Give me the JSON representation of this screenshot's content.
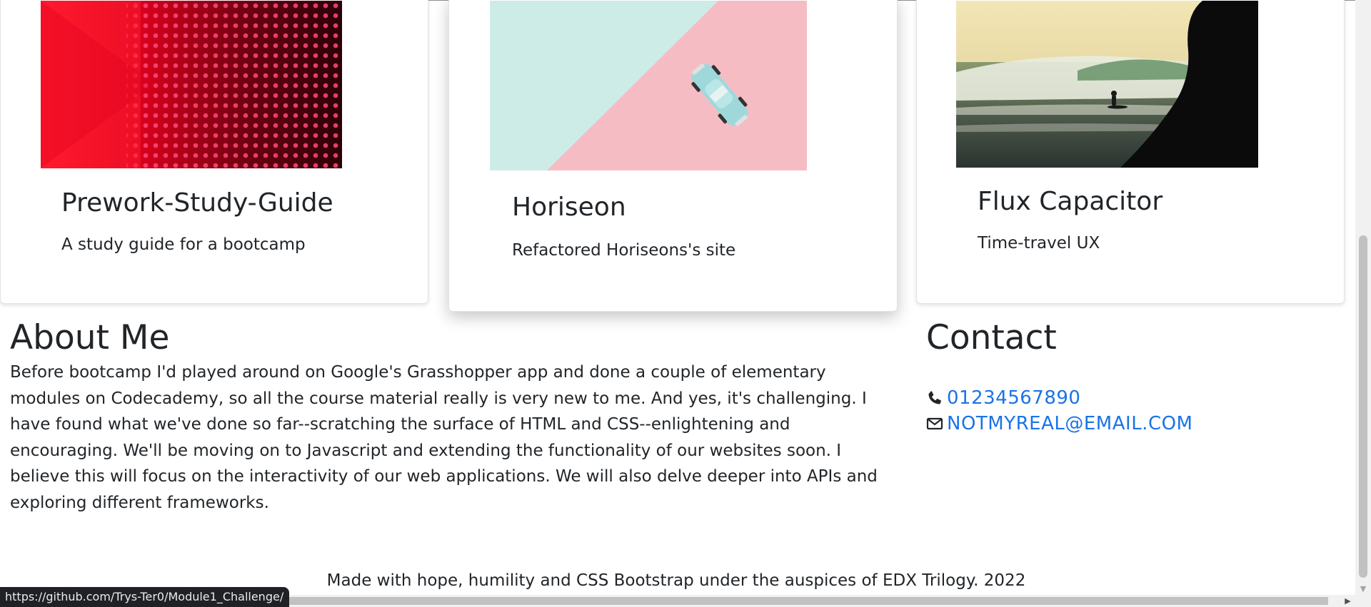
{
  "projects": [
    {
      "title": "Prework-Study-Guide",
      "description": "A study guide for a bootcamp"
    },
    {
      "title": "Horiseon",
      "description": "Refactored Horiseons's site"
    },
    {
      "title": "Flux Capacitor",
      "description": "Time-travel UX"
    }
  ],
  "about": {
    "title": "About Me",
    "text": "Before bootcamp I'd played around on Google's Grasshopper app and done a couple of elementary modules on Codecademy, so all the course material really is very new to me. And yes, it's challenging. I have found what we've done so far--scratching the surface of HTML and CSS--enlightening and encouraging. We'll be moving on to Javascript and extending the functionality of our websites soon. I believe this will focus on the interactivity of our web applications. We will also delve deeper into APIs and exploring different frameworks."
  },
  "contact": {
    "title": "Contact",
    "phone": "01234567890",
    "email": "NOTMYREAL@EMAIL.COM",
    "phone_icon": "phone-icon",
    "email_icon": "envelope-icon"
  },
  "footer": {
    "text": "Made with hope, humility and CSS Bootstrap under the auspices of EDX Trilogy. 2022"
  },
  "status_bar": {
    "url": "https://github.com/Trys-Ter0/Module1_Challenge/"
  },
  "colors": {
    "link": "#1a73e8",
    "text": "#212529"
  }
}
